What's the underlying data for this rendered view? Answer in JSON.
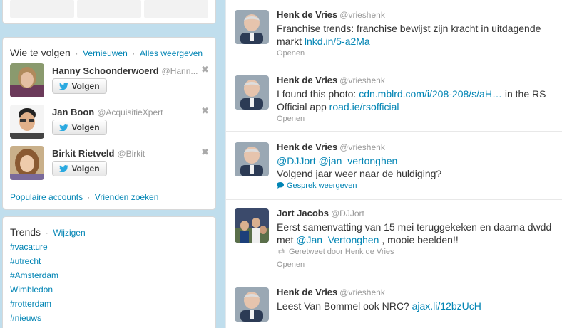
{
  "who_to_follow": {
    "title": "Wie te volgen",
    "refresh": "Vernieuwen",
    "view_all": "Alles weergeven",
    "follow_label": "Volgen",
    "users": [
      {
        "name": "Hanny Schoonderwoerd",
        "handle": "@Hann..."
      },
      {
        "name": "Jan Boon",
        "handle": "@AcquisitieXpert"
      },
      {
        "name": "Birkit Rietveld",
        "handle": "@Birkit"
      }
    ],
    "footer": {
      "popular": "Populaire accounts",
      "find_friends": "Vrienden zoeken"
    }
  },
  "trends": {
    "title": "Trends",
    "change": "Wijzigen",
    "items": [
      "#vacature",
      "#utrecht",
      "#Amsterdam",
      "Wimbledon",
      "#rotterdam",
      "#nieuws"
    ]
  },
  "timeline": {
    "tweets": [
      {
        "name": "Henk de Vries",
        "handle": "@vrieshenk",
        "text_before": "Franchise trends: franchise bewijst zijn kracht in uitdagende markt ",
        "link1": "lnkd.in/5-a2Ma",
        "action": "Openen"
      },
      {
        "name": "Henk de Vries",
        "handle": "@vrieshenk",
        "text_before": "I found this photo: ",
        "link1": "cdn.mblrd.com/i/208-208/s/aH…",
        "text_middle": " in the RS Official app ",
        "link2": "road.ie/rsofficial",
        "action": "Openen"
      },
      {
        "name": "Henk de Vries",
        "handle": "@vrieshenk",
        "mention1": "@DJJort",
        "mention2": "@jan_vertonghen",
        "text_after": "Volgend jaar weer naar de huldiging?",
        "action": "Gesprek weergeven"
      },
      {
        "name": "Jort Jacobs",
        "handle": "@DJJort",
        "text_before": "Eerst samenvatting van 15 mei teruggekeken en daarna dwdd met ",
        "mention1": "@Jan_Vertonghen",
        "text_after": " , mooie beelden!!",
        "retweeted_by": "Geretweet door Henk de Vries",
        "action": "Openen"
      },
      {
        "name": "Henk de Vries",
        "handle": "@vrieshenk",
        "text_before": "Leest Van Bommel ook NRC? ",
        "link1": "ajax.li/12bzUcH"
      }
    ]
  },
  "colors": {
    "background": "#c0deed",
    "link": "#0084b4",
    "muted": "#999999"
  },
  "icons": [
    "bird-icon",
    "close-icon",
    "conversation-icon",
    "retweet-icon"
  ]
}
